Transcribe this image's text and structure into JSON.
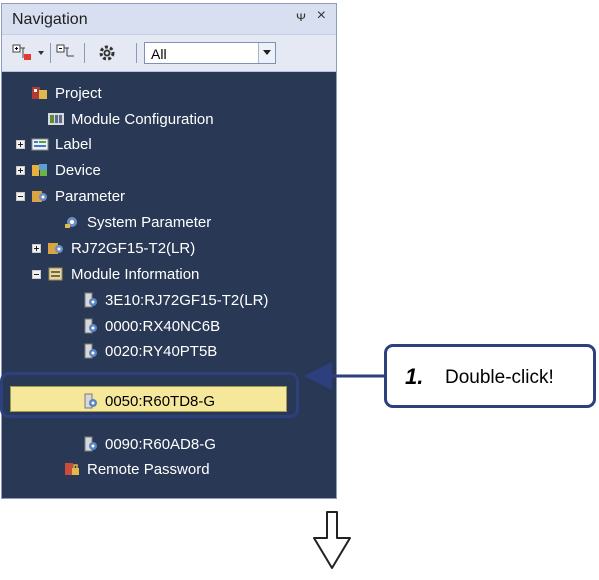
{
  "navigation": {
    "title": "Navigation",
    "pin_glyph": "չ",
    "close_glyph": "×",
    "toolbar": {
      "filter_value": "All"
    },
    "tree": [
      {
        "label": "Project",
        "indent": 0,
        "expander": "none",
        "icon": "project-icon"
      },
      {
        "label": "Module Configuration",
        "indent": 1,
        "expander": "none",
        "icon": "module-config-icon"
      },
      {
        "label": "Label",
        "indent": 0,
        "expander": "plus",
        "icon": "label-icon"
      },
      {
        "label": "Device",
        "indent": 0,
        "expander": "plus",
        "icon": "device-icon"
      },
      {
        "label": "Parameter",
        "indent": 0,
        "expander": "minus",
        "icon": "parameter-icon"
      },
      {
        "label": "System Parameter",
        "indent": 2,
        "expander": "none",
        "icon": "system-parameter-icon"
      },
      {
        "label": "RJ72GF15-T2(LR)",
        "indent": 1,
        "expander": "plus",
        "icon": "cpu-parameter-icon"
      },
      {
        "label": "Module Information",
        "indent": 1,
        "expander": "minus",
        "icon": "module-information-icon"
      },
      {
        "label": "3E10:RJ72GF15-T2(LR)",
        "indent": 3,
        "expander": "none",
        "icon": "module-icon"
      },
      {
        "label": "0000:RX40NC6B",
        "indent": 3,
        "expander": "none",
        "icon": "module-icon"
      },
      {
        "label": "0020:RY40PT5B",
        "indent": 3,
        "expander": "none",
        "icon": "module-icon"
      },
      {
        "label": "0050:R60TD8-G",
        "indent": 3,
        "expander": "none",
        "icon": "module-icon",
        "selected": true
      },
      {
        "label": "0090:R60AD8-G",
        "indent": 3,
        "expander": "none",
        "icon": "module-icon"
      },
      {
        "label": "Remote Password",
        "indent": 2,
        "expander": "none",
        "icon": "remote-password-icon"
      }
    ]
  },
  "callout": {
    "step": "1.",
    "text": "Double-click!"
  },
  "colors": {
    "panel_bg": "#293955",
    "selected_bg": "#f5e89a",
    "frame": "#2d3f7d"
  }
}
